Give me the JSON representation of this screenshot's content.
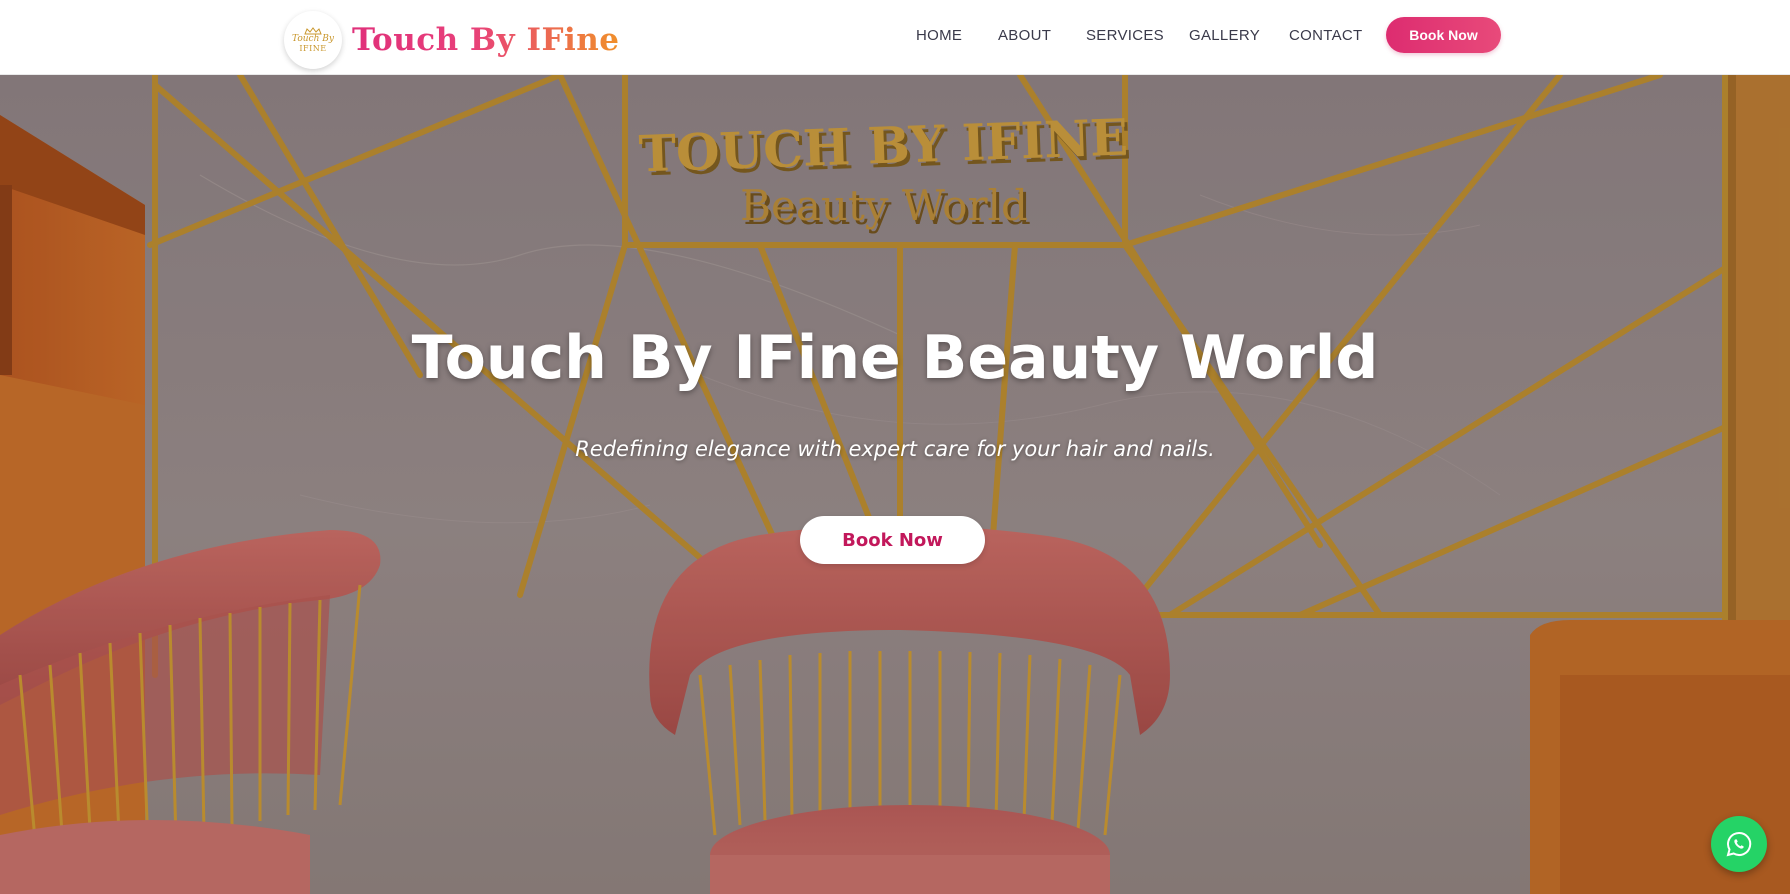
{
  "header": {
    "logo_badge": {
      "line1": "Touch By",
      "line2": "IFINE"
    },
    "brand": "Touch By IFine",
    "nav": [
      {
        "label": "HOME"
      },
      {
        "label": "ABOUT"
      },
      {
        "label": "SERVICES"
      },
      {
        "label": "GALLERY"
      },
      {
        "label": "CONTACT"
      }
    ],
    "book_label": "Book Now"
  },
  "hero": {
    "sign_line1": "TOUCH BY IFINE",
    "sign_line2": "Beauty World",
    "title": "Touch By IFine Beauty World",
    "subtitle": "Redefining elegance with expert care for your hair and nails.",
    "cta_label": "Book Now"
  },
  "floating": {
    "whatsapp_icon": "whatsapp-icon"
  },
  "colors": {
    "brand_pink": "#dd2c70",
    "brand_orange": "#f0902a",
    "cta_text": "#c2185b",
    "whatsapp_green": "#25d366",
    "gold": "#c9972c"
  }
}
